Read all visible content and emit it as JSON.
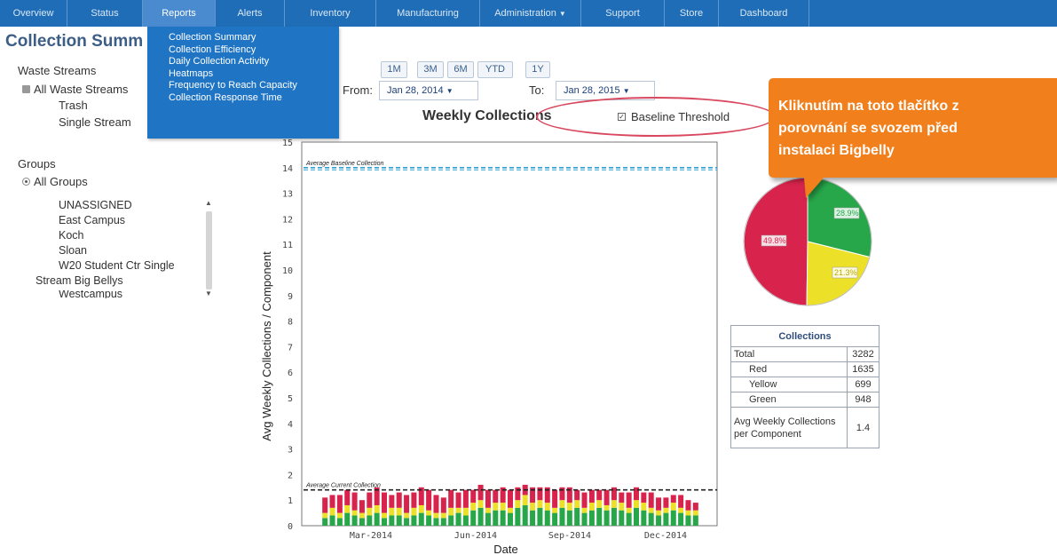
{
  "nav": {
    "items": [
      "Overview",
      "Status",
      "Reports",
      "Alerts",
      "Inventory",
      "Manufacturing",
      "Administration",
      "Support",
      "Store",
      "Dashboard"
    ],
    "active": "Reports",
    "reports_menu": [
      "Collection Summary",
      "Collection Efficiency",
      "Daily Collection Activity",
      "Heatmaps",
      "Frequency to Reach Capacity",
      "Collection Response Time"
    ]
  },
  "page": {
    "title": "Collection Summ"
  },
  "left_panel": {
    "waste_streams_label": "Waste Streams",
    "all_waste_streams": "All Waste Streams",
    "streams": [
      "Trash",
      "Single Stream"
    ],
    "groups_label": "Groups",
    "all_groups": "All Groups",
    "groups": [
      "UNASSIGNED",
      "East Campus",
      "Koch",
      "Sloan",
      "W20 Student Ctr Single",
      "Stream Big Bellys",
      "Westcampus"
    ]
  },
  "range": {
    "buttons": [
      "1M",
      "3M",
      "6M",
      "YTD",
      "1Y"
    ],
    "from_label": "From:",
    "from_value": "Jan 28, 2014",
    "to_label": "To:",
    "to_value": "Jan 28, 2015"
  },
  "chart_header": {
    "title": "Weekly Collections",
    "baseline_toggle": "Baseline Threshold"
  },
  "callout": {
    "lines": [
      "Kliknutím na toto tlačítko z",
      "porovnání se svozem před",
      "instalaci Bigbelly"
    ]
  },
  "colors": {
    "red": "#d8244c",
    "yellow": "#ede028",
    "green": "#27a74a",
    "nav": "#1f6db6",
    "callout": "#f07f1c",
    "dashed": "#2f9fd8"
  },
  "chart_data": {
    "type": "bar",
    "stacked": true,
    "title": "",
    "xlabel": "Date",
    "ylabel": "Avg Weekly Collections / Component",
    "ylim": [
      0,
      15
    ],
    "yticks": [
      0,
      1,
      2,
      3,
      4,
      5,
      6,
      7,
      8,
      9,
      10,
      11,
      12,
      13,
      14,
      15
    ],
    "xticks": [
      "Mar-2014",
      "Jun-2014",
      "Sep-2014",
      "Dec-2014"
    ],
    "reference_lines": [
      {
        "label": "Average Baseline Collection",
        "value": 14
      },
      {
        "label": "Average Current Collection",
        "value": 1.4
      }
    ],
    "series": [
      {
        "name": "Green",
        "values": [
          0.3,
          0.4,
          0.3,
          0.5,
          0.4,
          0.3,
          0.4,
          0.5,
          0.3,
          0.4,
          0.4,
          0.3,
          0.4,
          0.5,
          0.4,
          0.3,
          0.3,
          0.4,
          0.5,
          0.4,
          0.6,
          0.7,
          0.5,
          0.6,
          0.6,
          0.5,
          0.7,
          0.8,
          0.6,
          0.7,
          0.6,
          0.5,
          0.7,
          0.6,
          0.7,
          0.5,
          0.6,
          0.7,
          0.6,
          0.7,
          0.6,
          0.5,
          0.7,
          0.6,
          0.5,
          0.4,
          0.5,
          0.6,
          0.5,
          0.4,
          0.4
        ]
      },
      {
        "name": "Yellow",
        "values": [
          0.2,
          0.3,
          0.2,
          0.3,
          0.2,
          0.2,
          0.3,
          0.3,
          0.2,
          0.3,
          0.3,
          0.2,
          0.3,
          0.3,
          0.2,
          0.2,
          0.2,
          0.3,
          0.2,
          0.3,
          0.3,
          0.3,
          0.2,
          0.3,
          0.3,
          0.2,
          0.3,
          0.4,
          0.3,
          0.3,
          0.3,
          0.2,
          0.3,
          0.3,
          0.3,
          0.2,
          0.3,
          0.3,
          0.2,
          0.3,
          0.3,
          0.2,
          0.3,
          0.3,
          0.2,
          0.2,
          0.2,
          0.3,
          0.2,
          0.2,
          0.2
        ]
      },
      {
        "name": "Red",
        "values": [
          0.6,
          0.5,
          0.7,
          0.6,
          0.7,
          0.5,
          0.6,
          0.7,
          0.8,
          0.5,
          0.6,
          0.7,
          0.6,
          0.7,
          0.8,
          0.7,
          0.6,
          0.7,
          0.6,
          0.7,
          0.5,
          0.6,
          0.7,
          0.5,
          0.6,
          0.7,
          0.5,
          0.4,
          0.6,
          0.5,
          0.6,
          0.7,
          0.5,
          0.6,
          0.4,
          0.6,
          0.5,
          0.4,
          0.6,
          0.5,
          0.4,
          0.6,
          0.5,
          0.4,
          0.6,
          0.5,
          0.4,
          0.3,
          0.5,
          0.4,
          0.3
        ]
      }
    ]
  },
  "pie": {
    "slices": [
      {
        "name": "Red",
        "pct": 49.8,
        "label": "49.8%",
        "color": "#d8244c"
      },
      {
        "name": "Green",
        "pct": 28.9,
        "label": "28.9%",
        "color": "#27a74a"
      },
      {
        "name": "Yellow",
        "pct": 21.3,
        "label": "21.3%",
        "color": "#ede028"
      }
    ]
  },
  "table": {
    "header": "Collections",
    "rows": [
      {
        "label": "Total",
        "value": "3282"
      },
      {
        "label": "Red",
        "value": "1635"
      },
      {
        "label": "Yellow",
        "value": "699"
      },
      {
        "label": "Green",
        "value": "948"
      }
    ],
    "avg_label": "Avg Weekly Collections per Component",
    "avg_value": "1.4"
  }
}
